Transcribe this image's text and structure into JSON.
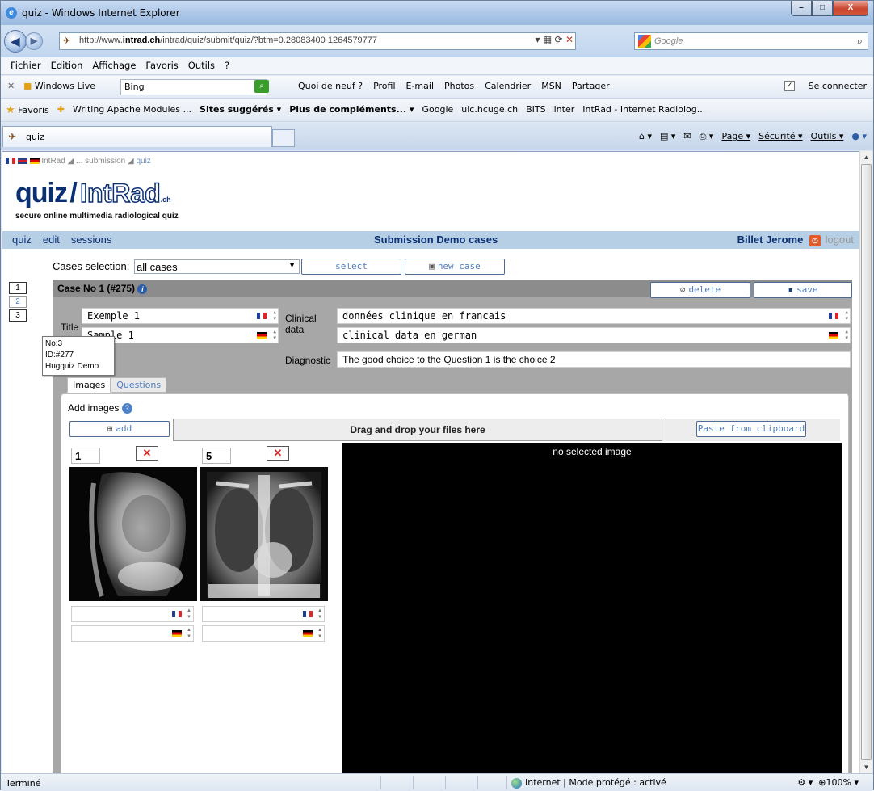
{
  "window": {
    "title": "quiz - Windows Internet Explorer",
    "minimize_glyph": "–",
    "maximize_glyph": "□",
    "close_glyph": "X"
  },
  "address": {
    "url_prefix": "http://www.",
    "url_domain": "intrad.ch",
    "url_rest": "/intrad/quiz/submit/quiz/?btm=0.28083400 1264579777",
    "search_placeholder": "Google"
  },
  "menu": [
    "Fichier",
    "Edition",
    "Affichage",
    "Favoris",
    "Outils",
    "?"
  ],
  "livebar": {
    "brand": "Windows Live",
    "bing_value": "Bing",
    "links": [
      "Quoi de neuf ?",
      "Profil",
      "E-mail",
      "Photos",
      "Calendrier",
      "MSN",
      "Partager"
    ],
    "connect": "Se connecter"
  },
  "favbar": {
    "favoris": "Favoris",
    "items": [
      "Writing Apache Modules ...",
      "Sites suggérés ▾",
      "Plus de compléments... ▾",
      "Google",
      "uic.hcuge.ch",
      "BITS",
      "inter",
      "IntRad - Internet Radiolog..."
    ]
  },
  "tab": {
    "label": "quiz"
  },
  "cmdbar": [
    "Page ▾",
    "Sécurité ▾",
    "Outils ▾"
  ],
  "page": {
    "breadcrumb": {
      "a": "IntRad ◢",
      "b": "... submission ◢",
      "c": "quiz"
    },
    "logo": {
      "quiz": "quiz",
      "slash": "/",
      "intrad": "IntRad",
      "ch": ".ch"
    },
    "tagline": "secure online multimedia radiological quiz",
    "nav": {
      "links": [
        "quiz",
        "edit",
        "sessions"
      ],
      "center": "Submission Demo cases",
      "user": "Billet Jerome",
      "logout": "logout"
    },
    "cases_selection_label": "Cases selection:",
    "cases_selection_value": "all cases",
    "select_button": "select",
    "new_case_button": "new case",
    "case_numbers": [
      "1",
      "2",
      "3"
    ],
    "case_header": "Case No 1 (#275)",
    "delete_button": "delete",
    "save_button": "save",
    "title_label": "Title",
    "title_fr": "Exemple 1",
    "title_de": "Sample 1",
    "clinical_label_1": "Clinical",
    "clinical_label_2": "data",
    "clinical_fr": "données clinique en francais",
    "clinical_de": "clinical data en german",
    "diagnostic_label": "Diagnostic",
    "diagnostic_value": "The good choice to the Question 1 is the choice 2",
    "tooltip": {
      "line1": "No:3",
      "line2": "ID:#277",
      "line3": "Hugquiz Demo"
    },
    "tabs": [
      "Images",
      "Questions"
    ],
    "add_images_label": "Add images",
    "add_button": "add",
    "dropzone": "Drag and drop your files here",
    "paste_button": "Paste from clipboard",
    "viewer_message": "no selected image",
    "thumbs": [
      {
        "num": "1",
        "remove": "✕"
      },
      {
        "num": "5",
        "remove": "✕"
      }
    ]
  },
  "status": {
    "left": "Terminé",
    "zone": "Internet | Mode protégé : activé",
    "zoom": "100%"
  }
}
